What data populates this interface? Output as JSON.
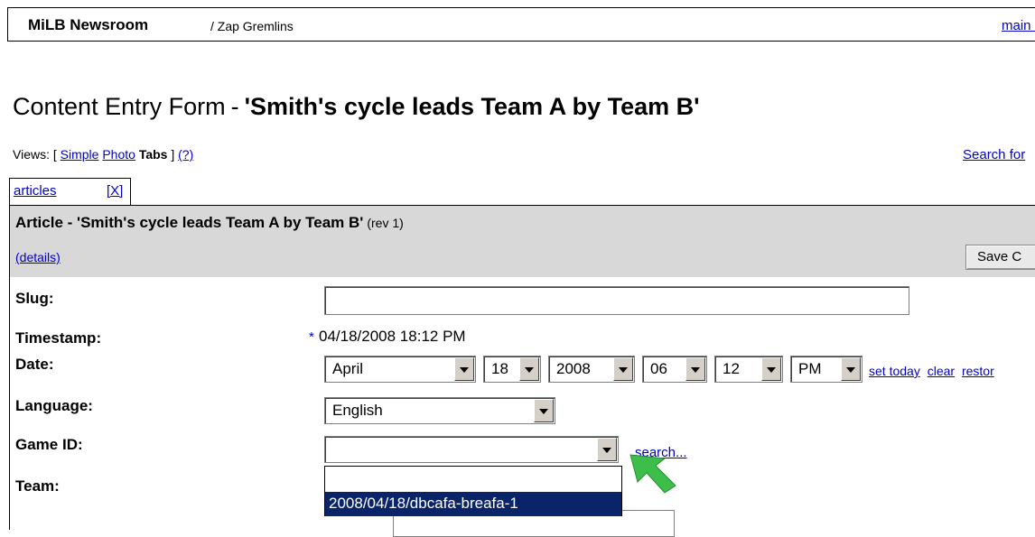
{
  "topbar": {
    "brand": "MiLB Newsroom",
    "breadcrumb": "/ Zap Gremlins",
    "main_link": "main m"
  },
  "heading": {
    "prefix": "Content Entry Form",
    "dash": "-",
    "title": "'Smith's cycle leads Team A by Team B'"
  },
  "views": {
    "label": "Views: [",
    "simple": "Simple",
    "photo": "Photo",
    "tabs": "Tabs",
    "close_bracket": "]",
    "help": "(?)"
  },
  "search_for": "Search for",
  "tab": {
    "label": "articles",
    "close": "[X]"
  },
  "article": {
    "title_prefix": "Article - ",
    "title": "'Smith's cycle leads Team A by Team B'",
    "rev": "(rev 1)",
    "details": "(details)",
    "save_label": "Save C"
  },
  "form": {
    "slug_label": "Slug:",
    "slug_value": "",
    "timestamp_label": "Timestamp:",
    "timestamp_star": "*",
    "timestamp_value": "04/18/2008 18:12 PM",
    "date_label": "Date:",
    "date_month": "April",
    "date_day": "18",
    "date_year": "2008",
    "date_hour": "06",
    "date_minute": "12",
    "date_ampm": "PM",
    "set_today": "set today",
    "clear": "clear",
    "restore": "restor",
    "language_label": "Language:",
    "language_value": "English",
    "game_id_label": "Game ID:",
    "game_id_value": "",
    "game_search": "search...",
    "team_label": "Team:"
  },
  "game_dropdown": {
    "options": [
      "",
      "2008/04/18/dbcafa-breafa-1"
    ],
    "highlighted_index": 1
  },
  "colors": {
    "link": "#0000cc",
    "panel_bg": "#d8d8d8",
    "highlight": "#0a246a",
    "arrow": "#3dbd4a"
  }
}
